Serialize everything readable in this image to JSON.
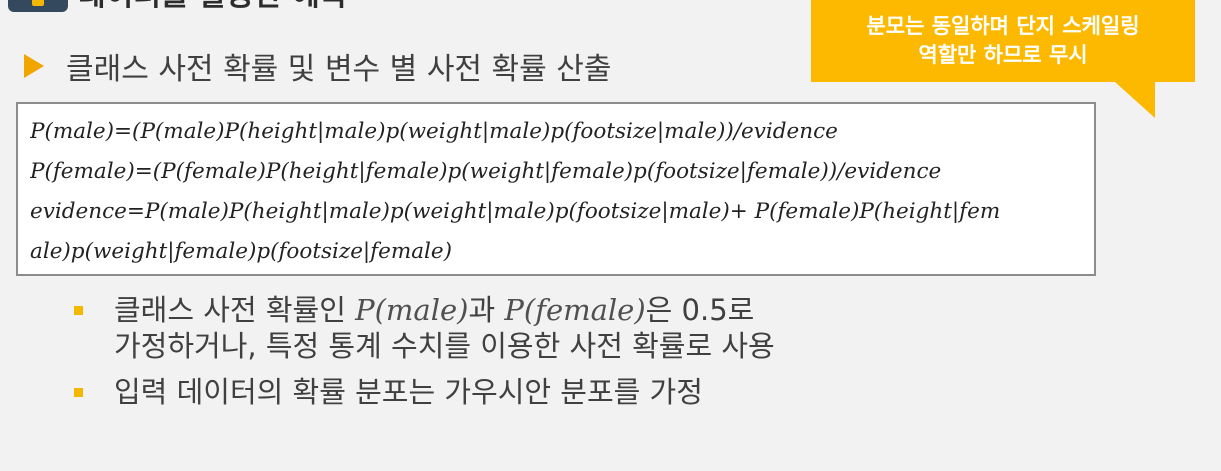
{
  "title": {
    "text": "데이터를 활용한 예측"
  },
  "heading": {
    "text": "클래스 사전 확률 및 변수 별 사전 확률 산출"
  },
  "callout": {
    "line1": "분모는 동일하며 단지 스케일링",
    "line2": "역할만 하므로 무시"
  },
  "formulas": [
    "P(male)=(P(male)P(height|male)p(weight|male)p(footsize|male))/evidence",
    "P(female)=(P(female)P(height|female)p(weight|female)p(footsize|female))/evidence",
    "evidence=P(male)P(height|male)p(weight|male)p(footsize|male)+ P(female)P(height|fem",
    "ale)p(weight|female)p(footsize|female)"
  ],
  "bullets": [
    {
      "part1": "클래스 사전 확률인 ",
      "math1": "P(male)",
      "part2": "과 ",
      "math2": "P(female)",
      "part3": "은 0.5로",
      "line2": "가정하거나, 특정 통계 수치를 이용한 사전 확률로 사용"
    },
    {
      "text": "입력 데이터의 확률 분포는 가우시안 분포를 가정"
    }
  ],
  "colors": {
    "accent": "#fcb900",
    "bullet": "#f5b800",
    "arrow": "#f0a500",
    "text": "#404040"
  }
}
